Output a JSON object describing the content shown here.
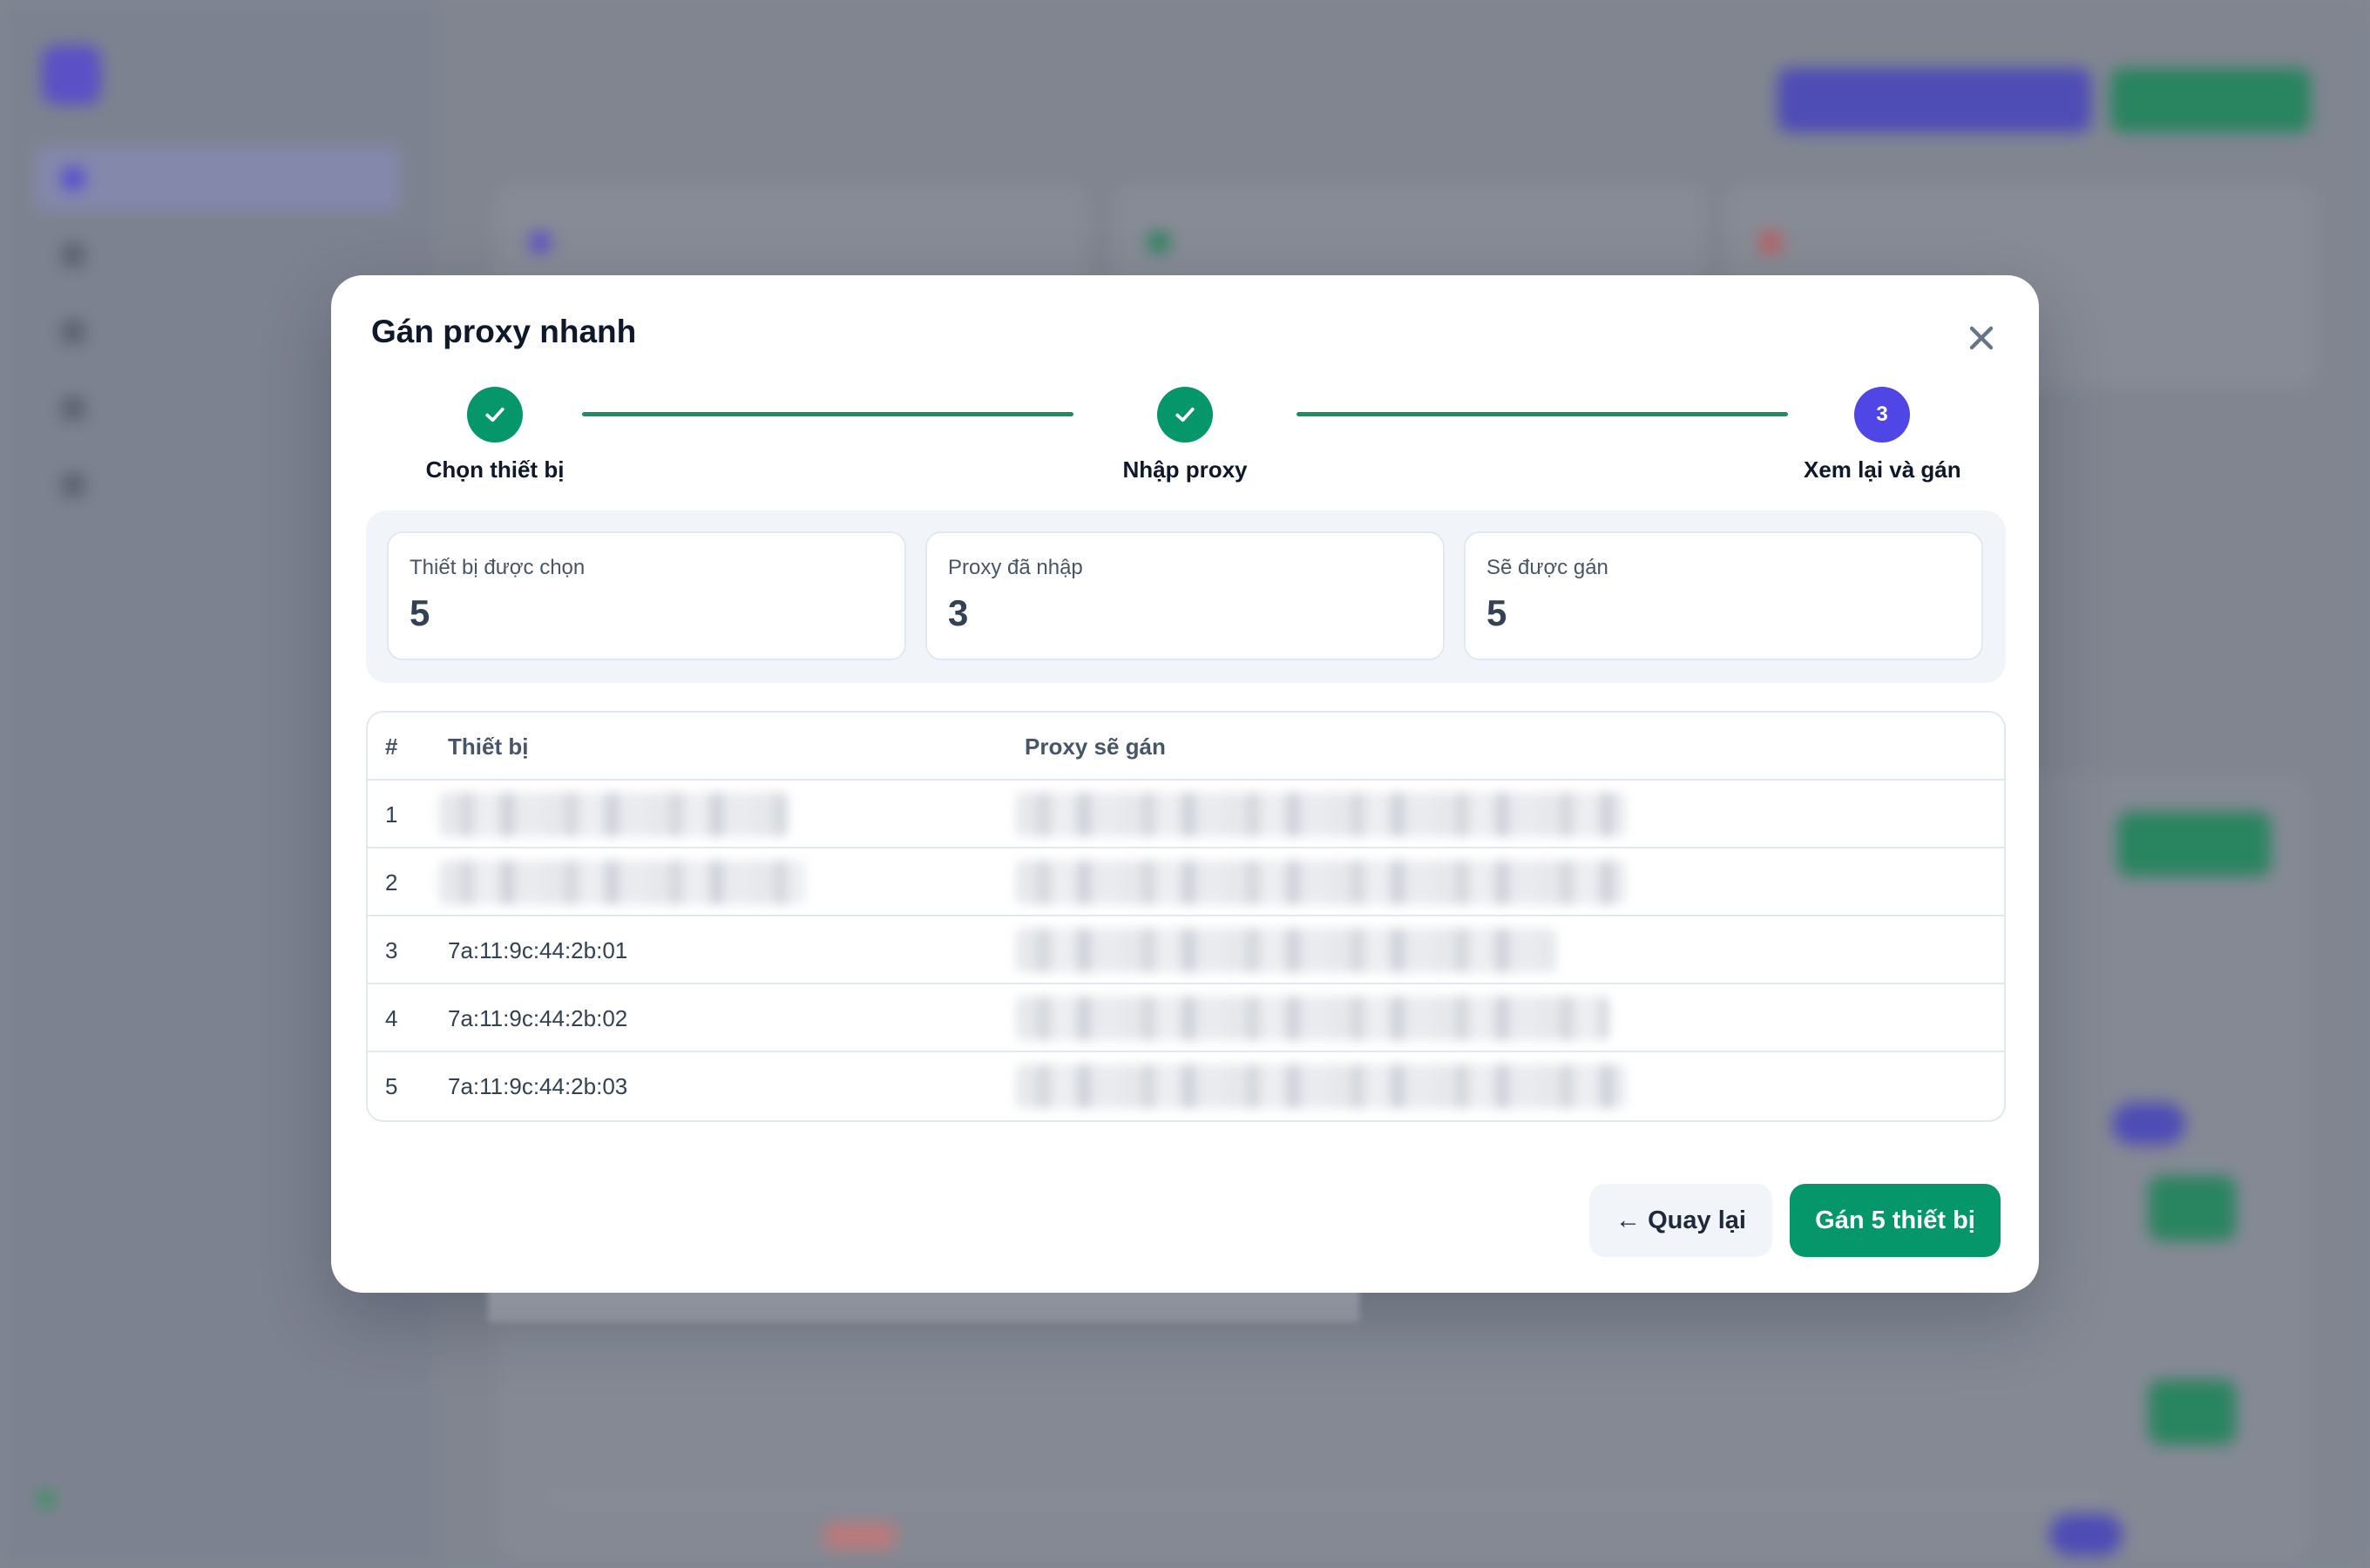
{
  "modal": {
    "title": "Gán proxy nhanh",
    "close_icon": "close-icon"
  },
  "stepper": {
    "steps": [
      {
        "label": "Chọn thiết bị",
        "state": "done",
        "icon": "check-icon"
      },
      {
        "label": "Nhập proxy",
        "state": "done",
        "icon": "check-icon"
      },
      {
        "label": "Xem lại và gán",
        "state": "current",
        "number": "3"
      }
    ]
  },
  "stats": {
    "selected_devices": {
      "label": "Thiết bị được chọn",
      "value": "5"
    },
    "proxies_entered": {
      "label": "Proxy đã nhập",
      "value": "3"
    },
    "will_assign": {
      "label": "Sẽ được gán",
      "value": "5"
    }
  },
  "table": {
    "headers": {
      "index": "#",
      "device": "Thiết bị",
      "proxy": "Proxy sẽ gán"
    },
    "rows": [
      {
        "index": "1",
        "device": "",
        "proxy": ""
      },
      {
        "index": "2",
        "device": "",
        "proxy": ""
      },
      {
        "index": "3",
        "device": "7a:11:9c:44:2b:01",
        "proxy": ""
      },
      {
        "index": "4",
        "device": "7a:11:9c:44:2b:02",
        "proxy": ""
      },
      {
        "index": "5",
        "device": "7a:11:9c:44:2b:03",
        "proxy": ""
      }
    ]
  },
  "actions": {
    "back_label": "← Quay lại",
    "assign_label": "Gán 5 thiết bị"
  },
  "colors": {
    "primary_green": "#059669",
    "step_current": "#4f46e5",
    "connector": "#16915f"
  }
}
